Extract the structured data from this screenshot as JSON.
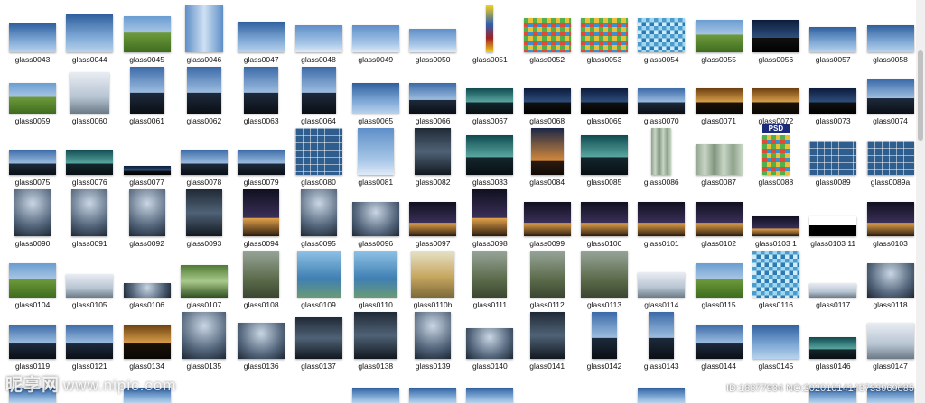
{
  "items": [
    {
      "label": "glass0043",
      "style": "ti-sky",
      "w": 52,
      "h": 32
    },
    {
      "label": "glass0044",
      "style": "ti-sky",
      "w": 52,
      "h": 42
    },
    {
      "label": "glass0045",
      "style": "ti-green",
      "w": 52,
      "h": 40
    },
    {
      "label": "glass0046",
      "style": "ti-vert",
      "w": 42,
      "h": 52
    },
    {
      "label": "glass0047",
      "style": "ti-sky",
      "w": 52,
      "h": 34
    },
    {
      "label": "glass0048",
      "style": "ti-skyl",
      "w": 52,
      "h": 30
    },
    {
      "label": "glass0049",
      "style": "ti-skyl",
      "w": 52,
      "h": 30
    },
    {
      "label": "glass0050",
      "style": "ti-skyl",
      "w": 52,
      "h": 26
    },
    {
      "label": "glass0051",
      "style": "ti-strip",
      "w": 8,
      "h": 52
    },
    {
      "label": "glass0052",
      "style": "ti-mosaic",
      "w": 52,
      "h": 38
    },
    {
      "label": "glass0053",
      "style": "ti-mosaic",
      "w": 52,
      "h": 38
    },
    {
      "label": "glass0054",
      "style": "ti-tiles",
      "w": 52,
      "h": 38
    },
    {
      "label": "glass0055",
      "style": "ti-green",
      "w": 52,
      "h": 36
    },
    {
      "label": "glass0056",
      "style": "ti-cityd",
      "w": 52,
      "h": 36
    },
    {
      "label": "glass0057",
      "style": "ti-sky",
      "w": 52,
      "h": 28
    },
    {
      "label": "glass0058",
      "style": "ti-sky",
      "w": 52,
      "h": 30
    },
    {
      "label": "glass0059",
      "style": "ti-green",
      "w": 52,
      "h": 34
    },
    {
      "label": "glass0060",
      "style": "ti-bright",
      "w": 44,
      "h": 46
    },
    {
      "label": "glass0061",
      "style": "ti-city",
      "w": 38,
      "h": 52
    },
    {
      "label": "glass0062",
      "style": "ti-city",
      "w": 38,
      "h": 52
    },
    {
      "label": "glass0063",
      "style": "ti-city",
      "w": 38,
      "h": 52
    },
    {
      "label": "glass0064",
      "style": "ti-city",
      "w": 38,
      "h": 52
    },
    {
      "label": "glass0065",
      "style": "ti-sky",
      "w": 52,
      "h": 34
    },
    {
      "label": "glass0066",
      "style": "ti-city",
      "w": 52,
      "h": 34
    },
    {
      "label": "glass0067",
      "style": "ti-teal",
      "w": 52,
      "h": 28
    },
    {
      "label": "glass0068",
      "style": "ti-cityd",
      "w": 52,
      "h": 28
    },
    {
      "label": "glass0069",
      "style": "ti-cityd",
      "w": 52,
      "h": 28
    },
    {
      "label": "glass0070",
      "style": "ti-city",
      "w": 52,
      "h": 28
    },
    {
      "label": "glass0071",
      "style": "ti-gold",
      "w": 52,
      "h": 28
    },
    {
      "label": "glass0072",
      "style": "ti-gold",
      "w": 52,
      "h": 28
    },
    {
      "label": "glass0073",
      "style": "ti-cityd",
      "w": 52,
      "h": 28
    },
    {
      "label": "glass0074",
      "style": "ti-city",
      "w": 52,
      "h": 38
    },
    {
      "label": "glass0075",
      "style": "ti-city",
      "w": 52,
      "h": 28
    },
    {
      "label": "glass0076",
      "style": "ti-teal",
      "w": 52,
      "h": 28
    },
    {
      "label": "glass0077",
      "style": "ti-cityd",
      "w": 52,
      "h": 10
    },
    {
      "label": "glass0078",
      "style": "ti-city",
      "w": 52,
      "h": 28
    },
    {
      "label": "glass0079",
      "style": "ti-city",
      "w": 52,
      "h": 28
    },
    {
      "label": "glass0080",
      "style": "ti-grid",
      "w": 52,
      "h": 52
    },
    {
      "label": "glass0081",
      "style": "ti-skyl",
      "w": 40,
      "h": 52
    },
    {
      "label": "glass0082",
      "style": "ti-dark",
      "w": 40,
      "h": 52
    },
    {
      "label": "glass0083",
      "style": "ti-teal",
      "w": 52,
      "h": 44
    },
    {
      "label": "glass0084",
      "style": "ti-dusk",
      "w": 36,
      "h": 52
    },
    {
      "label": "glass0085",
      "style": "ti-teal",
      "w": 52,
      "h": 44
    },
    {
      "label": "glass0086",
      "style": "ti-glassblk",
      "w": 22,
      "h": 52
    },
    {
      "label": "glass0087",
      "style": "ti-glassblk",
      "w": 52,
      "h": 34
    },
    {
      "label": "glass0088",
      "style": "ti-mosaic",
      "w": 30,
      "h": 44,
      "badge": "PSD"
    },
    {
      "label": "glass0089",
      "style": "ti-grid",
      "w": 52,
      "h": 38
    },
    {
      "label": "glass0089a",
      "style": "ti-grid",
      "w": 52,
      "h": 38
    },
    {
      "label": "glass0090",
      "style": "ti-atrium",
      "w": 40,
      "h": 52
    },
    {
      "label": "glass0091",
      "style": "ti-atrium",
      "w": 40,
      "h": 52
    },
    {
      "label": "glass0092",
      "style": "ti-atrium",
      "w": 40,
      "h": 52
    },
    {
      "label": "glass0093",
      "style": "ti-dark",
      "w": 40,
      "h": 52
    },
    {
      "label": "glass0094",
      "style": "ti-night",
      "w": 40,
      "h": 52
    },
    {
      "label": "glass0095",
      "style": "ti-atrium",
      "w": 40,
      "h": 52
    },
    {
      "label": "glass0096",
      "style": "ti-atrium",
      "w": 52,
      "h": 38
    },
    {
      "label": "glass0097",
      "style": "ti-night",
      "w": 52,
      "h": 38
    },
    {
      "label": "glass0098",
      "style": "ti-night",
      "w": 38,
      "h": 52
    },
    {
      "label": "glass0099",
      "style": "ti-night",
      "w": 52,
      "h": 38
    },
    {
      "label": "glass0100",
      "style": "ti-night",
      "w": 52,
      "h": 38
    },
    {
      "label": "glass0101",
      "style": "ti-night",
      "w": 52,
      "h": 38
    },
    {
      "label": "glass0102",
      "style": "ti-night",
      "w": 52,
      "h": 38
    },
    {
      "label": "glass0103 1",
      "style": "ti-night",
      "w": 52,
      "h": 22
    },
    {
      "label": "glass0103 11",
      "style": "ti-silh",
      "w": 52,
      "h": 22
    },
    {
      "label": "glass0103",
      "style": "ti-night",
      "w": 52,
      "h": 38
    },
    {
      "label": "glass0104",
      "style": "ti-green",
      "w": 52,
      "h": 38
    },
    {
      "label": "glass0105",
      "style": "ti-bright",
      "w": 52,
      "h": 26
    },
    {
      "label": "glass0106",
      "style": "ti-atrium",
      "w": 52,
      "h": 16
    },
    {
      "label": "glass0107",
      "style": "ti-trees",
      "w": 52,
      "h": 36
    },
    {
      "label": "glass0108",
      "style": "ti-aerial",
      "w": 40,
      "h": 52
    },
    {
      "label": "glass0109",
      "style": "ti-fade",
      "w": 48,
      "h": 52
    },
    {
      "label": "glass0110",
      "style": "ti-fade",
      "w": 48,
      "h": 52
    },
    {
      "label": "glass0110h",
      "style": "ti-sand",
      "w": 48,
      "h": 52
    },
    {
      "label": "glass0111",
      "style": "ti-aerial",
      "w": 38,
      "h": 52
    },
    {
      "label": "glass0112",
      "style": "ti-aerial",
      "w": 38,
      "h": 52
    },
    {
      "label": "glass0113",
      "style": "ti-aerial",
      "w": 52,
      "h": 52
    },
    {
      "label": "glass0114",
      "style": "ti-bright",
      "w": 52,
      "h": 28
    },
    {
      "label": "glass0115",
      "style": "ti-green",
      "w": 52,
      "h": 38
    },
    {
      "label": "glass0116",
      "style": "ti-tiles",
      "w": 52,
      "h": 52
    },
    {
      "label": "glass0117",
      "style": "ti-bright",
      "w": 52,
      "h": 16
    },
    {
      "label": "glass0118",
      "style": "ti-atrium",
      "w": 52,
      "h": 38
    },
    {
      "label": "glass0119",
      "style": "ti-city",
      "w": 52,
      "h": 38
    },
    {
      "label": "glass0121",
      "style": "ti-city",
      "w": 52,
      "h": 38
    },
    {
      "label": "glass0134",
      "style": "ti-gold",
      "w": 52,
      "h": 38
    },
    {
      "label": "glass0135",
      "style": "ti-atrium",
      "w": 48,
      "h": 52
    },
    {
      "label": "glass0136",
      "style": "ti-atrium",
      "w": 52,
      "h": 40
    },
    {
      "label": "glass0137",
      "style": "ti-dark",
      "w": 52,
      "h": 46
    },
    {
      "label": "glass0138",
      "style": "ti-dark",
      "w": 48,
      "h": 52
    },
    {
      "label": "glass0139",
      "style": "ti-atrium",
      "w": 40,
      "h": 52
    },
    {
      "label": "glass0140",
      "style": "ti-atrium",
      "w": 52,
      "h": 34
    },
    {
      "label": "glass0141",
      "style": "ti-dark",
      "w": 38,
      "h": 52
    },
    {
      "label": "glass0142",
      "style": "ti-city",
      "w": 28,
      "h": 52
    },
    {
      "label": "glass0143",
      "style": "ti-city",
      "w": 28,
      "h": 52
    },
    {
      "label": "glass0144",
      "style": "ti-city",
      "w": 52,
      "h": 38
    },
    {
      "label": "glass0145",
      "style": "ti-sky",
      "w": 52,
      "h": 38
    },
    {
      "label": "glass0146",
      "style": "ti-teal",
      "w": 52,
      "h": 24
    },
    {
      "label": "glass0147",
      "style": "ti-bright",
      "w": 52,
      "h": 40
    }
  ],
  "watermark": {
    "brand": "昵享网",
    "site": "www.nipic.com",
    "id": "ID:18377934 NO:20201014143733969085"
  }
}
